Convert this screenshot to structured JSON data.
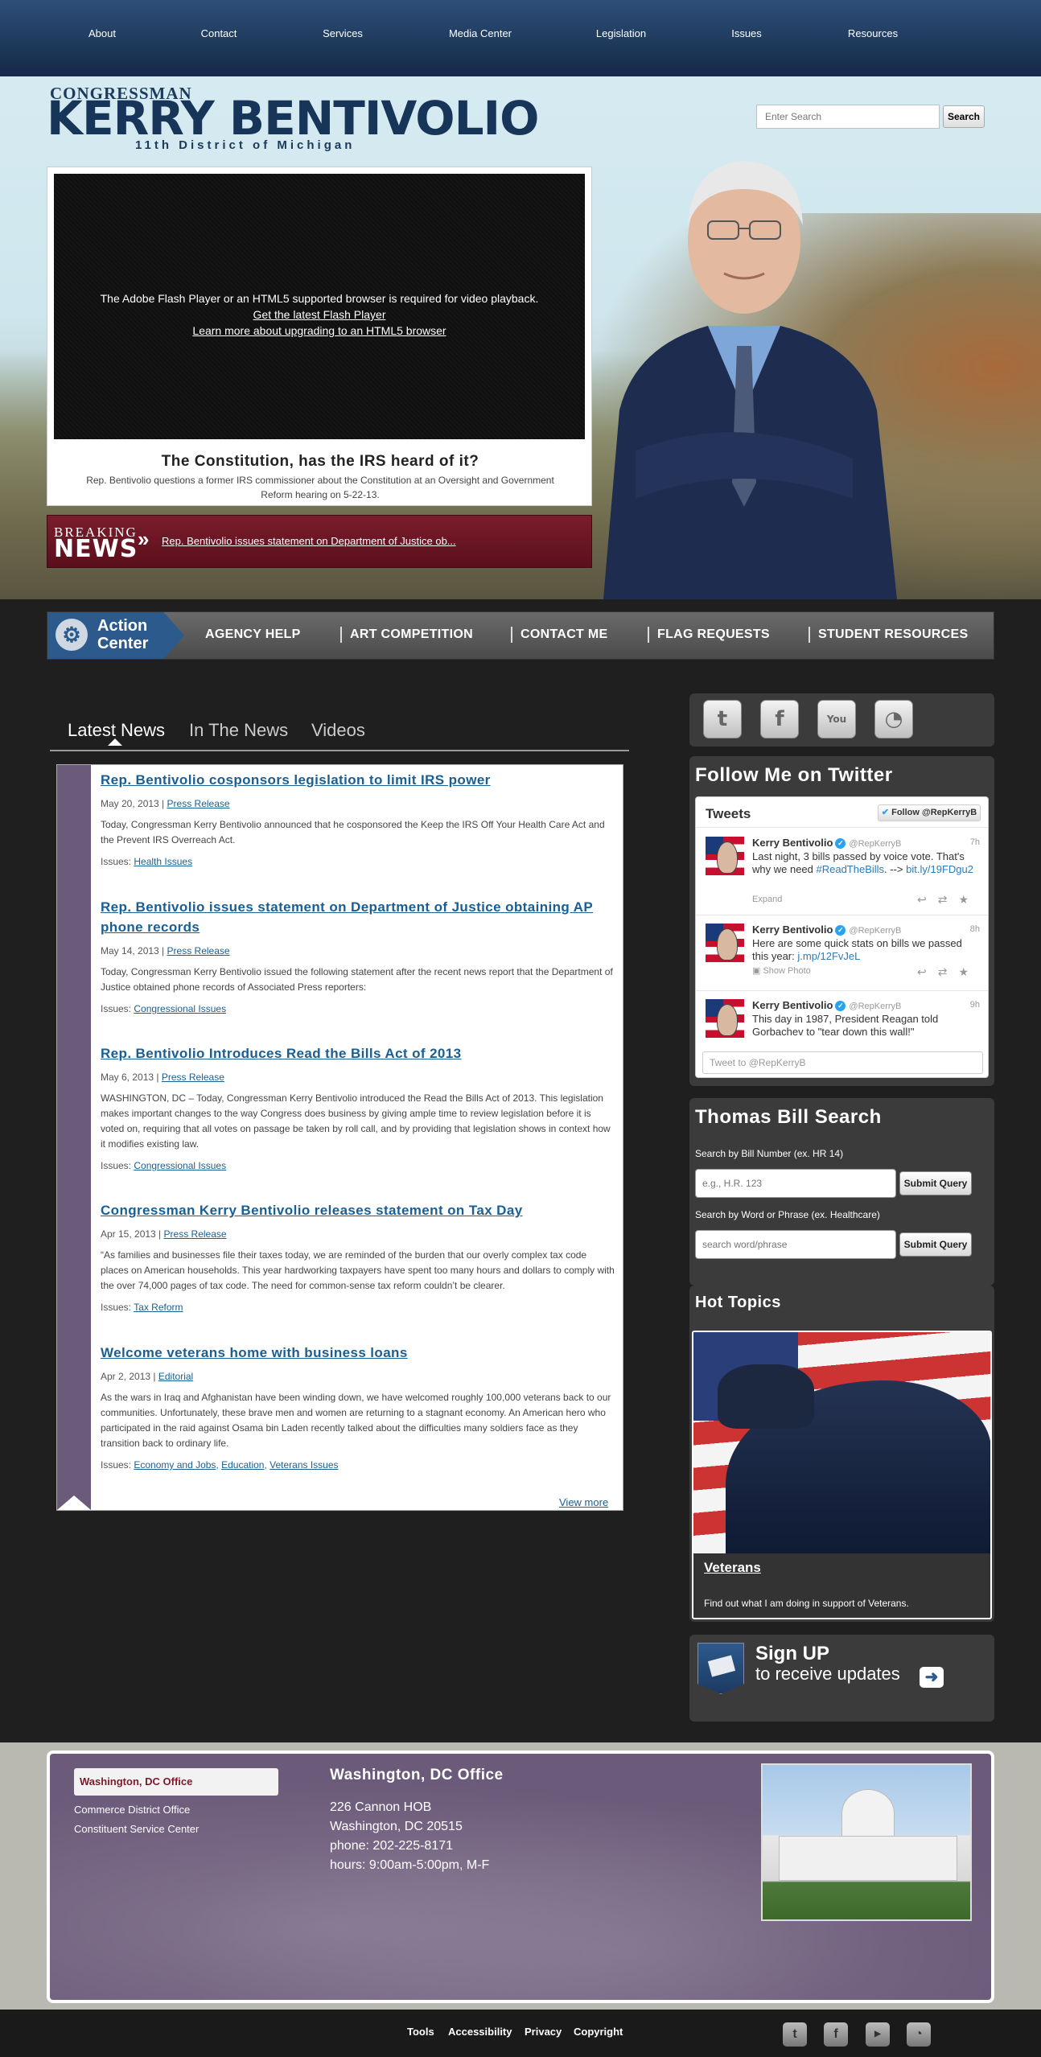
{
  "nav": {
    "items": [
      "About",
      "Contact",
      "Services",
      "Media Center",
      "Legislation",
      "Issues",
      "Resources"
    ]
  },
  "header": {
    "logo_small": "Congressman",
    "logo_big": "KERRY BENTIVOLIO",
    "logo_district": "11th District of Michigan",
    "search_placeholder": "Enter Search",
    "search_button": "Search"
  },
  "feature": {
    "video_msg": "The Adobe Flash Player or an HTML5 supported browser is required for video playback.",
    "video_link1": "Get the latest Flash Player",
    "video_link2": "Learn more about upgrading to an HTML5 browser",
    "title": "The Constitution, has the IRS heard of it?",
    "description": "Rep. Bentivolio questions a former IRS commissioner about the Constitution at an Oversight and Government Reform hearing on 5-22-13."
  },
  "breaking": {
    "label_top": "BREAKING",
    "label_bottom": "NEWS",
    "link": "Rep. Bentivolio issues statement on Department of Justice ob..."
  },
  "action_bar": {
    "center_line1": "Action",
    "center_line2": "Center",
    "items": [
      "AGENCY HELP",
      "ART COMPETITION",
      "CONTACT ME",
      "FLAG REQUESTS",
      "STUDENT RESOURCES"
    ]
  },
  "tabs": [
    "Latest News",
    "In The News",
    "Videos"
  ],
  "news": [
    {
      "title": "Rep. Bentivolio cosponsors legislation to limit IRS power",
      "date": "May 20, 2013",
      "category": "Press Release",
      "body": "Today, Congressman Kerry Bentivolio announced that he cosponsored the Keep the IRS Off Your Health Care Act and the Prevent IRS Overreach Act.",
      "issues": [
        "Health Issues"
      ]
    },
    {
      "title": "Rep. Bentivolio issues statement on Department of Justice obtaining AP phone records",
      "date": "May 14, 2013",
      "category": "Press Release",
      "body": "Today, Congressman Kerry Bentivolio issued the following statement after the recent news report that the Department of Justice obtained phone records of Associated Press reporters:",
      "issues": [
        "Congressional Issues"
      ]
    },
    {
      "title": "Rep. Bentivolio Introduces Read the Bills Act of 2013",
      "date": "May 6, 2013",
      "category": "Press Release",
      "body": "WASHINGTON, DC – Today, Congressman Kerry Bentivolio introduced the Read the Bills Act of 2013. This legislation makes important changes to the way Congress does business by giving ample time to review legislation before it is voted on, requiring that all votes on passage be taken by roll call, and by providing that legislation shows in context how it modifies existing law.",
      "issues": [
        "Congressional Issues"
      ]
    },
    {
      "title": "Congressman Kerry Bentivolio releases statement on Tax Day",
      "date": "Apr 15, 2013",
      "category": "Press Release",
      "body": "“As families and businesses file their taxes today, we are reminded of the burden that our overly complex tax code places on American households. This year hardworking taxpayers have spent too many hours and dollars to comply with the over 74,000 pages of tax code. The need for common-sense tax reform couldn’t be clearer.",
      "issues": [
        "Tax Reform"
      ]
    },
    {
      "title": "Welcome veterans home with business loans",
      "date": "Apr 2, 2013",
      "category": "Editorial",
      "body": "As the wars in Iraq and Afghanistan have been winding down, we have welcomed roughly 100,000 veterans back to our communities. Unfortunately, these brave men and women are returning to a stagnant economy. An American hero who participated in the raid against Osama bin Laden recently talked about the difficulties many soldiers face as they transition back to ordinary life.",
      "issues": [
        "Economy and Jobs",
        "Education",
        "Veterans Issues"
      ]
    }
  ],
  "issues_label": "Issues:",
  "view_more": "View more",
  "social_icons": [
    "twitter-icon",
    "facebook-icon",
    "youtube-icon",
    "rss-icon"
  ],
  "twitter": {
    "title": "Follow Me on Twitter",
    "widget_title": "Tweets",
    "follow_btn": "Follow @RepKerryB",
    "tweets": [
      {
        "name": "Kerry Bentivolio",
        "handle": "@RepKerryB",
        "time": "7h",
        "text": "Last night, 3 bills passed by voice vote. That's why we need ",
        "tag": "#ReadTheBills",
        "text2": ". -->",
        "link": "bit.ly/19FDgu2",
        "extra": "Expand"
      },
      {
        "name": "Kerry Bentivolio",
        "handle": "@RepKerryB",
        "time": "8h",
        "text": "Here are some quick stats on bills we passed this year: ",
        "tag": "",
        "text2": "",
        "link": "j.mp/12FvJeL",
        "extra": "Show Photo"
      },
      {
        "name": "Kerry Bentivolio",
        "handle": "@RepKerryB",
        "time": "9h",
        "text": "This day in 1987, President Reagan told Gorbachev to \"tear down this wall!\"",
        "tag": "",
        "text2": "",
        "link": "",
        "extra": ""
      }
    ],
    "compose_placeholder": "Tweet to @RepKerryB"
  },
  "bill_search": {
    "title": "Thomas Bill Search",
    "label1": "Search by Bill Number (ex. HR 14)",
    "placeholder1": "e.g., H.R. 123",
    "label2": "Search by Word or Phrase (ex. Healthcare)",
    "placeholder2": "search word/phrase",
    "button": "Submit Query"
  },
  "hot_topics": {
    "title": "Hot Topics",
    "link": "Veterans",
    "description": "Find out what I am doing in support of Veterans."
  },
  "signup": {
    "line1": "Sign UP",
    "line2": "to receive updates",
    "arrow": "➜"
  },
  "footer": {
    "office_tabs": [
      "Washington, DC Office",
      "Commerce District Office",
      "Constituent Service Center"
    ],
    "office_title": "Washington, DC Office",
    "address1": "226 Cannon HOB",
    "address2": "Washington, DC 20515",
    "phone": "phone: 202-225-8171",
    "hours": "hours: 9:00am-5:00pm, M-F"
  },
  "bottom_links": [
    "Tools",
    "Accessibility",
    "Privacy",
    "Copyright"
  ],
  "colors": {
    "accent_purple": "#6b5a79",
    "nav_blue": "#1c3556",
    "breaking_red": "#7b1d2c",
    "link_blue": "#1a5f93"
  }
}
